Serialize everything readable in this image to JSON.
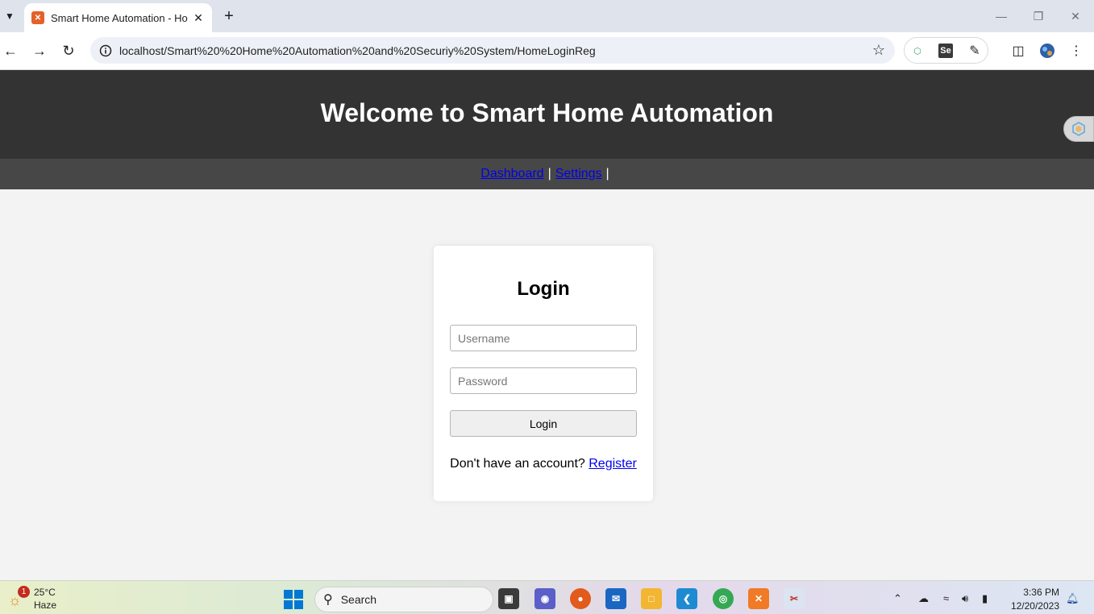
{
  "browser": {
    "tab_title": "Smart Home Automation - Home",
    "url": "localhost/Smart%20%20Home%20Automation%20and%20Securiy%20System/HomeLoginReg",
    "new_tab_label": "+"
  },
  "page": {
    "header_title": "Welcome to Smart Home Automation",
    "nav": {
      "dashboard": "Dashboard",
      "settings": "Settings",
      "separator": "|"
    },
    "login": {
      "heading": "Login",
      "username_placeholder": "Username",
      "password_placeholder": "Password",
      "button_label": "Login",
      "register_prompt": "Don't have an account?",
      "register_link": "Register"
    }
  },
  "taskbar": {
    "weather_temp": "25°C",
    "weather_condition": "Haze",
    "weather_badge": "1",
    "search_label": "Search",
    "time": "3:36 PM",
    "date": "12/20/2023"
  },
  "colors": {
    "header_bg": "#333333",
    "nav_bg": "#474747",
    "page_bg": "#f3f3f3",
    "link": "#0000ee"
  }
}
